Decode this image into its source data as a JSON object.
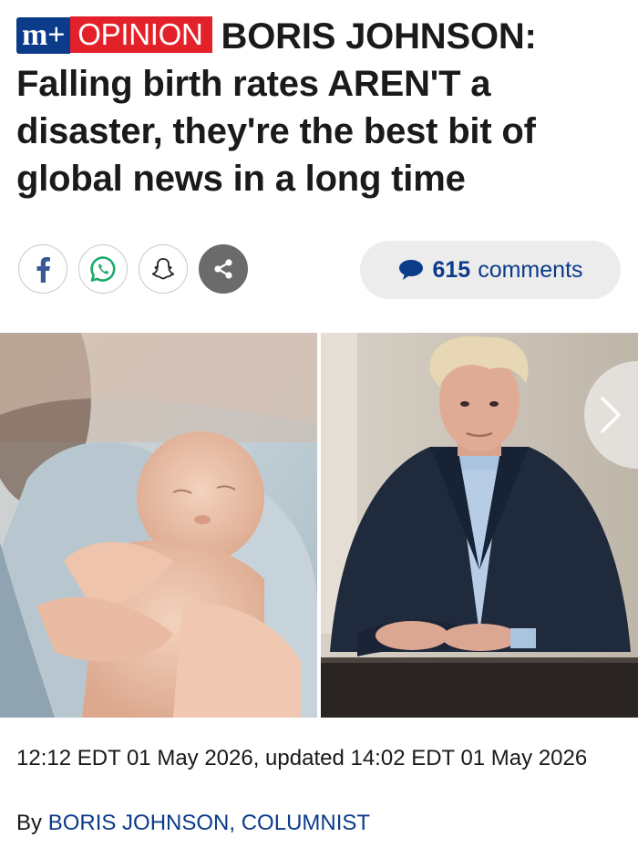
{
  "article": {
    "badge_plus": "m+",
    "badge_opinion": "OPINION",
    "headline": "BORIS JOHNSON: Falling birth rates AREN'T a disaster, they're the best bit of global news in a long time"
  },
  "share": {
    "buttons": [
      {
        "icon": "facebook-icon",
        "color": "#3b5998"
      },
      {
        "icon": "whatsapp-icon",
        "color": "#1aab6a"
      },
      {
        "icon": "snapchat-icon",
        "color": "#222222"
      },
      {
        "icon": "share-icon",
        "color": "#ffffff"
      }
    ],
    "comments_count": "615",
    "comments_label": "comments"
  },
  "gallery": {
    "images": [
      {
        "icon": "newborn-baby-photo"
      },
      {
        "icon": "boris-johnson-portrait-photo"
      }
    ],
    "next_icon": "chevron-right-icon"
  },
  "meta": {
    "timestamp": "12:12 EDT 01 May 2026, updated 14:02 EDT 01 May 2026",
    "by_prefix": "By",
    "author": "BORIS JOHNSON, COLUMNIST"
  },
  "colors": {
    "brand_blue": "#0c3b8a",
    "opinion_red": "#e3212a",
    "pill_bg": "#ececec"
  }
}
